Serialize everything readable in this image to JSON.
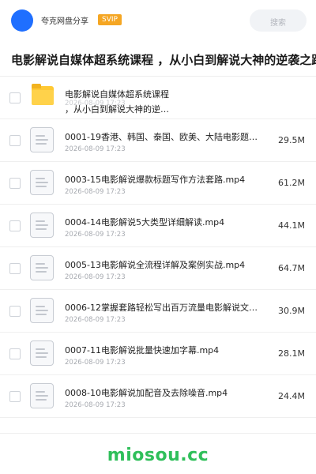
{
  "header": {
    "brand": "夸克网盘分享",
    "badge": "SVIP",
    "search_label": "搜索"
  },
  "title": "电影解说自媒体超系统课程 ，从小白到解说大神的逆袭之路",
  "folder": {
    "name_line1": "电影解说自媒体超系统课程",
    "name_line2": "，从小白到解说大神的逆…",
    "date": "2026-08-09 17:23"
  },
  "files": [
    {
      "name": "0001-19香港、韩国、泰国、欧美、大陆电影题材…",
      "date": "2026-08-09 17:23",
      "size": "29.5M"
    },
    {
      "name": "0003-15电影解说爆款标题写作方法套路.mp4",
      "date": "2026-08-09 17:23",
      "size": "61.2M"
    },
    {
      "name": "0004-14电影解说5大类型详细解读.mp4",
      "date": "2026-08-09 17:23",
      "size": "44.1M"
    },
    {
      "name": "0005-13电影解说全流程详解及案例实战.mp4",
      "date": "2026-08-09 17:23",
      "size": "64.7M"
    },
    {
      "name": "0006-12掌握套路轻松写出百万流量电影解说文案…",
      "date": "2026-08-09 17:23",
      "size": "30.9M"
    },
    {
      "name": "0007-11电影解说批量快速加字幕.mp4",
      "date": "2026-08-09 17:23",
      "size": "28.1M"
    },
    {
      "name": "0008-10电影解说加配音及去除噪音.mp4",
      "date": "2026-08-09 17:23",
      "size": "24.4M"
    }
  ],
  "watermark": "miosou.cc",
  "colors": {
    "avatar": "#1f6fff",
    "badge": "#f5a623",
    "folder": "#ffc933",
    "watermark": "#2fbf5a"
  },
  "icons": {
    "folder": "folder-icon",
    "file": "document-icon",
    "avatar": "avatar"
  }
}
